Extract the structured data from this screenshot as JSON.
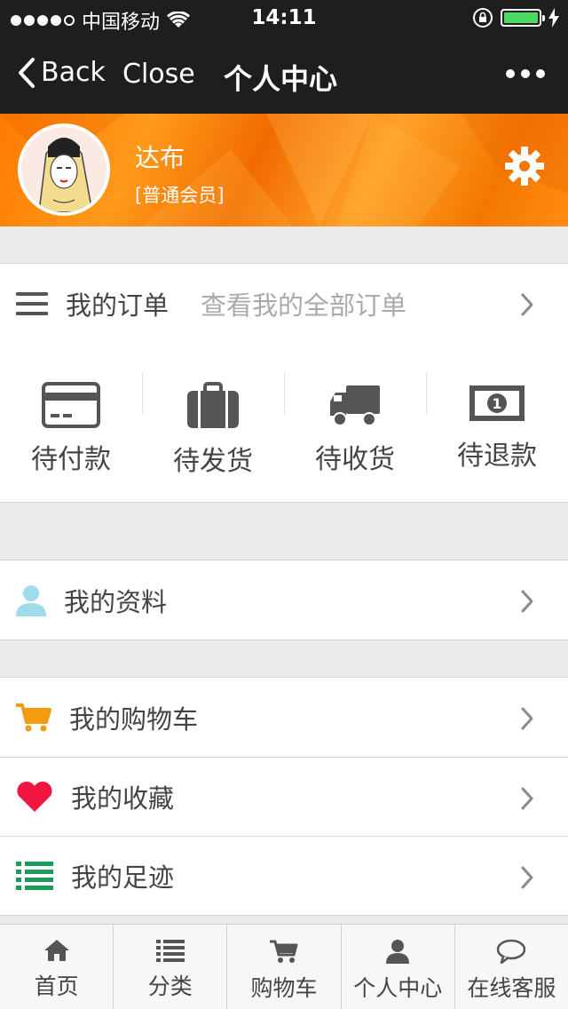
{
  "status_bar": {
    "carrier": "中国移动",
    "time": "14:11"
  },
  "nav": {
    "back_label": "Back",
    "close_label": "Close",
    "title": "个人中心"
  },
  "profile": {
    "username": "达布",
    "level": "[普通会员]"
  },
  "orders": {
    "title": "我的订单",
    "view_all": "查看我的全部订单",
    "states": [
      {
        "label": "待付款",
        "icon": "credit-card-icon"
      },
      {
        "label": "待发货",
        "icon": "briefcase-icon"
      },
      {
        "label": "待收货",
        "icon": "truck-icon"
      },
      {
        "label": "待退款",
        "icon": "banknote-icon"
      }
    ]
  },
  "menu": {
    "profile": {
      "label": "我的资料",
      "icon": "user-icon",
      "color": "#9fdbe9"
    },
    "cart": {
      "label": "我的购物车",
      "icon": "cart-icon",
      "color": "#f39c12"
    },
    "favorites": {
      "label": "我的收藏",
      "icon": "heart-icon",
      "color": "#f0163f"
    },
    "history": {
      "label": "我的足迹",
      "icon": "list-icon",
      "color": "#1c9a5a"
    }
  },
  "tabs": [
    {
      "label": "首页",
      "icon": "home-icon"
    },
    {
      "label": "分类",
      "icon": "list-icon"
    },
    {
      "label": "购物车",
      "icon": "cart-icon"
    },
    {
      "label": "个人中心",
      "icon": "user-icon"
    },
    {
      "label": "在线客服",
      "icon": "chat-bubble-icon"
    }
  ],
  "colors": {
    "header_orange": "#ff8a10",
    "nav_dark": "#1e1e1f",
    "battery_green": "#4cd964"
  }
}
